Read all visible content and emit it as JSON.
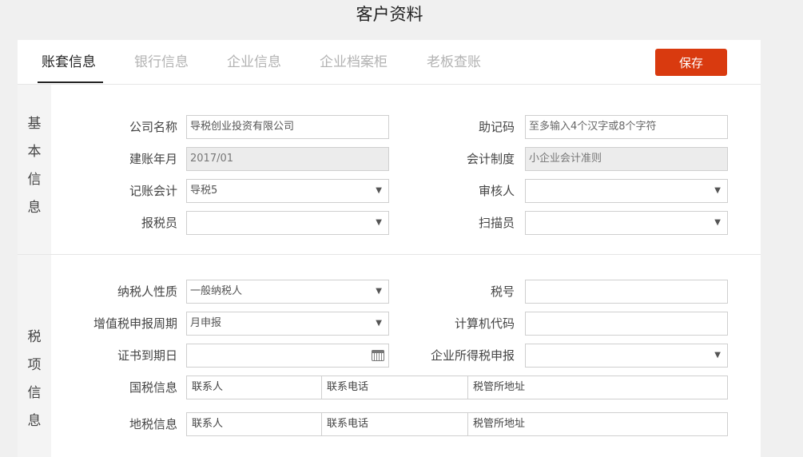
{
  "title": "客户资料",
  "tabs": [
    "账套信息",
    "银行信息",
    "企业信息",
    "企业档案柜",
    "老板查账"
  ],
  "save_label": "保存",
  "basic": {
    "section_chars": [
      "基",
      "本",
      "信",
      "息"
    ],
    "company_name_label": "公司名称",
    "company_name_value": "导税创业投资有限公司",
    "mnemonic_label": "助记码",
    "mnemonic_placeholder": "至多输入4个汉字或8个字符",
    "open_month_label": "建账年月",
    "open_month_value": "2017/01",
    "accounting_system_label": "会计制度",
    "accounting_system_value": "小企业会计准则",
    "bookkeeper_label": "记账会计",
    "bookkeeper_value": "导税5",
    "reviewer_label": "审核人",
    "reviewer_value": "",
    "tax_filer_label": "报税员",
    "tax_filer_value": "",
    "scanner_label": "扫描员",
    "scanner_value": ""
  },
  "tax": {
    "section_chars": [
      "税",
      "项",
      "信",
      "息"
    ],
    "taxpayer_type_label": "纳税人性质",
    "taxpayer_type_value": "一般纳税人",
    "tax_no_label": "税号",
    "tax_no_value": "",
    "vat_period_label": "增值税申报周期",
    "vat_period_value": "月申报",
    "computer_code_label": "计算机代码",
    "computer_code_value": "",
    "cert_expiry_label": "证书到期日",
    "cert_expiry_value": "",
    "cit_label": "企业所得税申报",
    "cit_value": "",
    "national_label": "国税信息",
    "local_label": "地税信息",
    "contact_label": "联系人",
    "phone_label": "联系电话",
    "office_label": "税管所地址"
  }
}
